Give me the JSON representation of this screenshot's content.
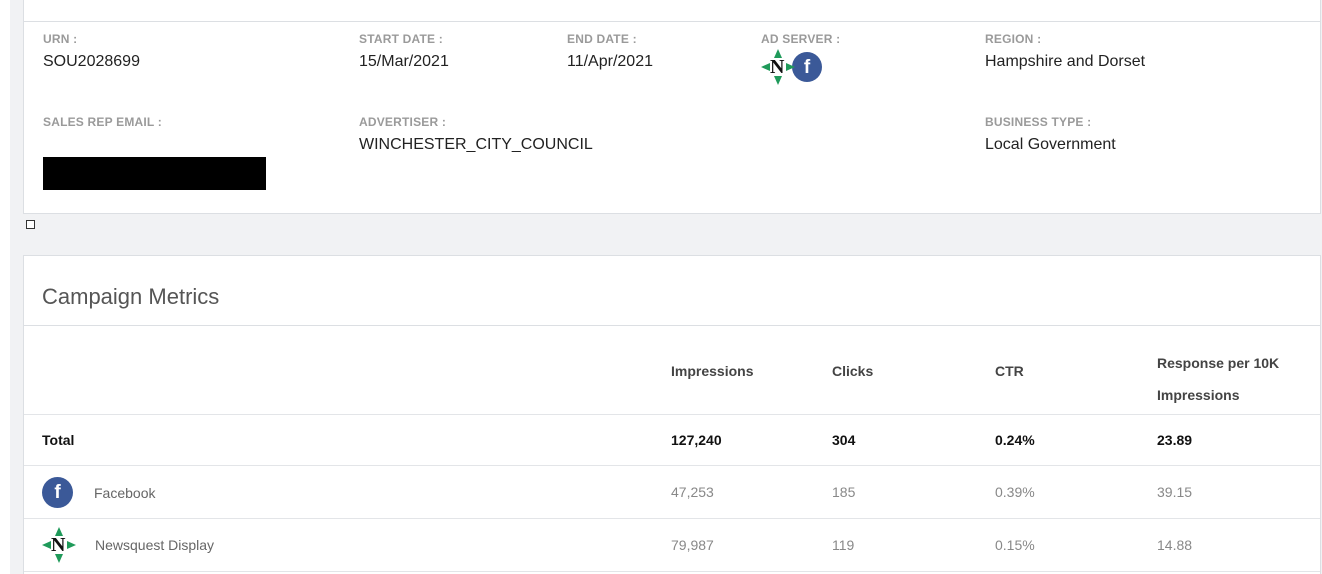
{
  "campaign_info": {
    "urn_label": "URN :",
    "urn": "SOU2028699",
    "start_date_label": "START DATE :",
    "start_date": "15/Mar/2021",
    "end_date_label": "END DATE :",
    "end_date": "11/Apr/2021",
    "ad_server_label": "AD SERVER :",
    "ad_server_icons": [
      "newsquest-icon",
      "facebook-icon"
    ],
    "region_label": "REGION :",
    "region": "Hampshire and Dorset",
    "sales_rep_email_label": "SALES REP EMAIL :",
    "sales_rep_email": "",
    "advertiser_label": "ADVERTISER :",
    "advertiser": "WINCHESTER_CITY_COUNCIL",
    "business_type_label": "BUSINESS TYPE :",
    "business_type": "Local Government"
  },
  "metrics": {
    "title": "Campaign Metrics",
    "columns": {
      "impressions": "Impressions",
      "clicks": "Clicks",
      "ctr": "CTR",
      "response_line1": "Response per 10K",
      "response_line2": "Impressions"
    },
    "total": {
      "label": "Total",
      "impressions": "127,240",
      "clicks": "304",
      "ctr": "0.24%",
      "response": "23.89"
    },
    "rows": [
      {
        "icon": "facebook-icon",
        "label": "Facebook",
        "impressions": "47,253",
        "clicks": "185",
        "ctr": "0.39%",
        "response": "39.15"
      },
      {
        "icon": "newsquest-icon",
        "label": "Newsquest Display",
        "impressions": "79,987",
        "clicks": "119",
        "ctr": "0.15%",
        "response": "14.88"
      }
    ]
  },
  "colors": {
    "facebook": "#3b5998",
    "newsquest_green": "#1f9a5a",
    "border": "#dcdfe3",
    "label_grey": "#9a9a9a"
  },
  "icon_glyphs": {
    "facebook_letter": "f",
    "newsquest_letter": "N"
  }
}
